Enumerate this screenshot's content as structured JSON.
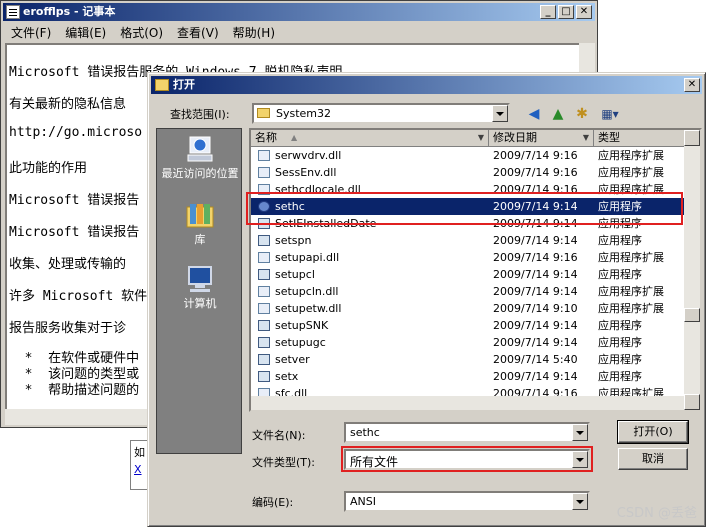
{
  "notepad": {
    "title": "erofflps - 记事本",
    "menu": [
      "文件(F)",
      "编辑(E)",
      "格式(O)",
      "查看(V)",
      "帮助(H)"
    ],
    "lines": [
      "Microsoft 错误报告服务的 Windows 7 脱机隐私声明",
      "有关最新的隐私信息",
      "http://go.microso",
      "此功能的作用",
      "Microsoft 错误报告",
      "Microsoft 错误报告",
      "收集、处理或传输的",
      "许多 Microsoft 软件",
      "报告服务收集对于诊",
      "  *  在软件或硬件中",
      "  *  该问题的类型或",
      "  *  帮助描述问题的"
    ]
  },
  "bg_dialog": {
    "text": "如",
    "link": "X"
  },
  "dialog": {
    "title": "打开",
    "look_in_label": "查找范围(I):",
    "look_in_value": "System32",
    "places": [
      {
        "label": "最近访问的位置",
        "icon": "recent-places-icon"
      },
      {
        "label": "库",
        "icon": "libraries-icon"
      },
      {
        "label": "计算机",
        "icon": "computer-icon"
      }
    ],
    "columns": [
      "名称",
      "修改日期",
      "类型"
    ],
    "files": [
      {
        "name": "serwvdrv.dll",
        "date": "2009/7/14 9:16",
        "type": "应用程序扩展",
        "icon": "dll"
      },
      {
        "name": "SessEnv.dll",
        "date": "2009/7/14 9:16",
        "type": "应用程序扩展",
        "icon": "dll"
      },
      {
        "name": "sethcdlocale.dll",
        "date": "2009/7/14 9:16",
        "type": "应用程序扩展",
        "icon": "dll"
      },
      {
        "name": "sethc",
        "date": "2009/7/14 9:14",
        "type": "应用程序",
        "icon": "gear"
      },
      {
        "name": "SetIEInstalledDate",
        "date": "2009/7/14 9:14",
        "type": "应用程序",
        "icon": "exe"
      },
      {
        "name": "setspn",
        "date": "2009/7/14 9:14",
        "type": "应用程序",
        "icon": "exe"
      },
      {
        "name": "setupapi.dll",
        "date": "2009/7/14 9:16",
        "type": "应用程序扩展",
        "icon": "dll"
      },
      {
        "name": "setupcl",
        "date": "2009/7/14 9:14",
        "type": "应用程序",
        "icon": "exe"
      },
      {
        "name": "setupcln.dll",
        "date": "2009/7/14 9:14",
        "type": "应用程序扩展",
        "icon": "dll"
      },
      {
        "name": "setupetw.dll",
        "date": "2009/7/14 9:10",
        "type": "应用程序扩展",
        "icon": "dll"
      },
      {
        "name": "setupSNK",
        "date": "2009/7/14 9:14",
        "type": "应用程序",
        "icon": "exe"
      },
      {
        "name": "setupugc",
        "date": "2009/7/14 9:14",
        "type": "应用程序",
        "icon": "exe"
      },
      {
        "name": "setver",
        "date": "2009/7/14 5:40",
        "type": "应用程序",
        "icon": "exe"
      },
      {
        "name": "setx",
        "date": "2009/7/14 9:14",
        "type": "应用程序",
        "icon": "exe"
      },
      {
        "name": "sfc.dll",
        "date": "2009/7/14 9:16",
        "type": "应用程序扩展",
        "icon": "dll"
      }
    ],
    "filename_label": "文件名(N):",
    "filename_value": "sethc",
    "filetype_label": "文件类型(T):",
    "filetype_value": "所有文件",
    "encoding_label": "编码(E):",
    "encoding_value": "ANSI",
    "open_button": "打开(O)",
    "cancel_button": "取消"
  },
  "watermark": "CSDN @丢爸",
  "colors": {
    "highlight_box": "#e02020",
    "selection": "#0a246a"
  }
}
